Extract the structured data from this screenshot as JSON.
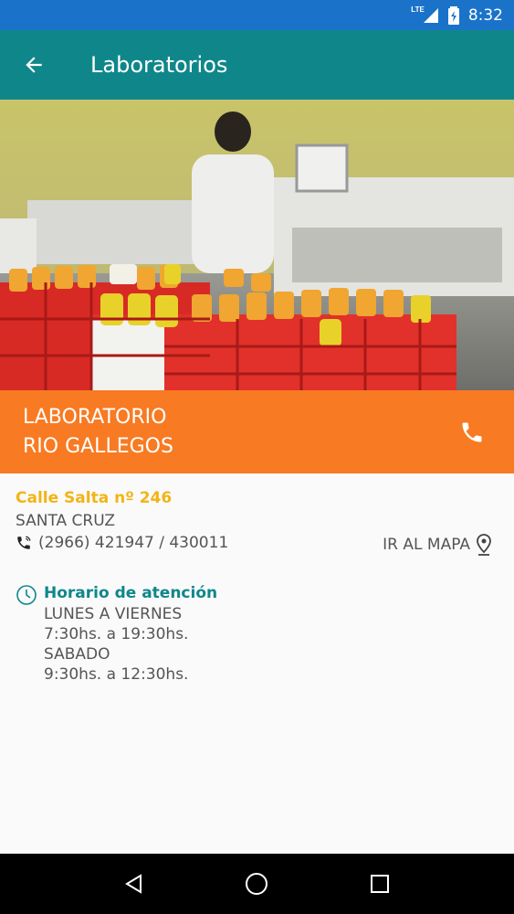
{
  "status_bar": {
    "time": "8:32",
    "network_label": "LTE",
    "icons": [
      "signal-icon",
      "battery-charging-icon"
    ]
  },
  "app_bar": {
    "title": "Laboratorios",
    "back_icon": "arrow-back-icon"
  },
  "hero": {
    "description_icon": "laboratory-photo"
  },
  "lab": {
    "name_line1": "LABORATORIO",
    "name_line2": "RIO GALLEGOS",
    "call_icon": "phone-icon"
  },
  "address": {
    "street": "Calle Salta nº 246",
    "province": "SANTA CRUZ",
    "phone": "(2966) 421947 / 430011",
    "map_label": "IR AL MAPA"
  },
  "hours": {
    "title": "Horario de atención",
    "lines": [
      "LUNES A VIERNES",
      "7:30hs. a 19:30hs.",
      "SABADO",
      "9:30hs. a 12:30hs."
    ]
  },
  "colors": {
    "status_bar": "#1a73c9",
    "app_bar": "#0f878a",
    "banner": "#f87a22",
    "street": "#f2b416",
    "hours_title": "#0f878a"
  }
}
